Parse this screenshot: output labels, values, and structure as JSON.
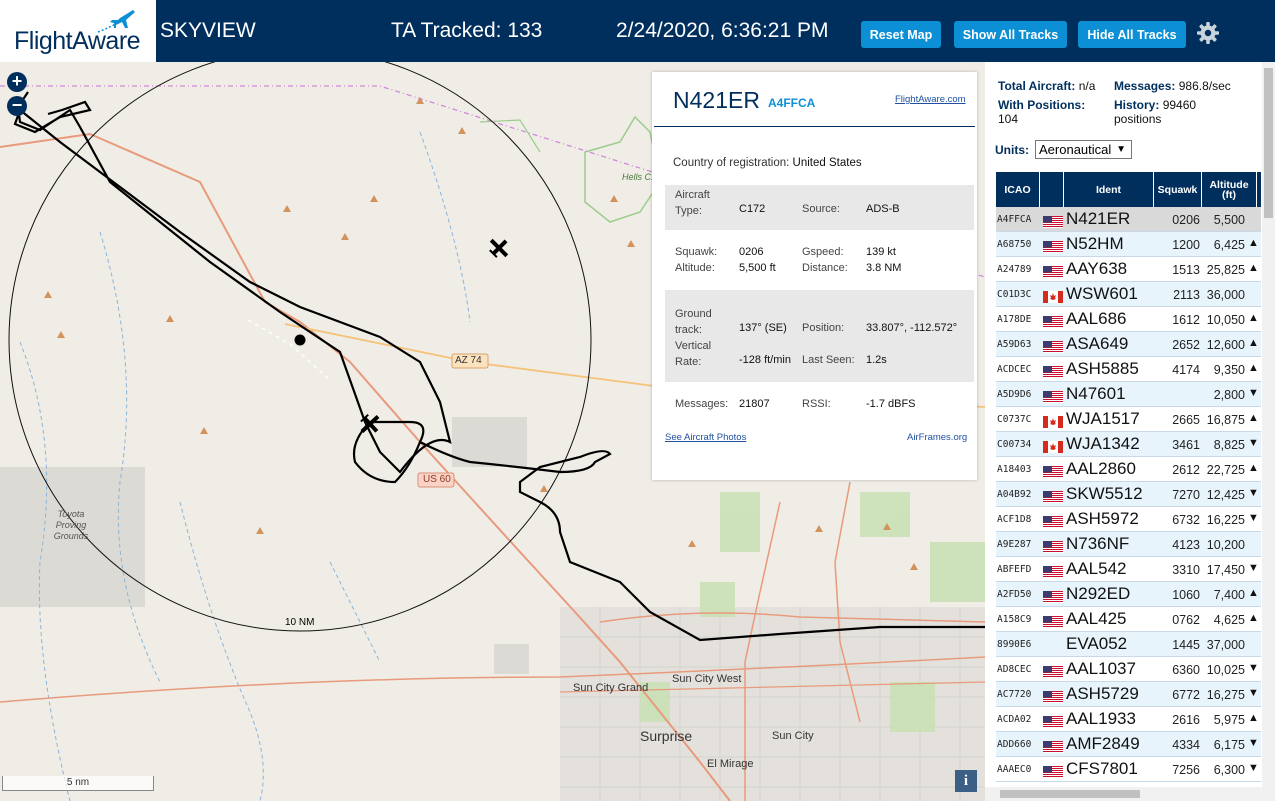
{
  "header": {
    "logo": "FlightAware",
    "app_title": "SKYVIEW",
    "ta_tracked": "TA Tracked: 133",
    "datetime": "2/24/2020, 6:36:21 PM",
    "reset_map": "Reset Map",
    "show_all_tracks": "Show All Tracks",
    "hide_all_tracks": "Hide All Tracks"
  },
  "map": {
    "zoom_in": "+",
    "zoom_out": "−",
    "range_ring_label": "10 NM",
    "scale_label": "5 nm",
    "info": "i",
    "labels": {
      "az74": "AZ 74",
      "us60": "US 60",
      "hells_canyon": "Hells C...",
      "toyota": "Toyota Proving Grounds",
      "sun_city_grand": "Sun City Grand",
      "sun_city_west": "Sun City West",
      "surprise": "Surprise",
      "sun_city": "Sun City",
      "el_mirage": "El Mirage"
    }
  },
  "aircraft": {
    "ident": "N421ER",
    "hex": "A4FFCA",
    "fa_link": "FlightAware.com",
    "country_label": "Country of registration:",
    "country": "United States",
    "type_label": "Aircraft Type:",
    "type": "C172",
    "source_label": "Source:",
    "source": "ADS-B",
    "squawk_label": "Squawk:",
    "squawk": "0206",
    "gspeed_label": "Gspeed:",
    "gspeed": "139 kt",
    "altitude_label": "Altitude:",
    "altitude": "5,500 ft",
    "distance_label": "Distance:",
    "distance": "3.8 NM",
    "track_label": "Ground track:",
    "track": "137° (SE)",
    "position_label": "Position:",
    "position": "33.807°, -112.572°",
    "vrate_label": "Vertical Rate:",
    "vrate": "-128 ft/min",
    "lastseen_label": "Last Seen:",
    "lastseen": "1.2s",
    "messages_label": "Messages:",
    "messages": "21807",
    "rssi_label": "RSSI:",
    "rssi": "-1.7 dBFS",
    "photos_link": "See Aircraft Photos",
    "airframes": "AirFrames.org"
  },
  "sidebar": {
    "total_label": "Total Aircraft:",
    "total": "n/a",
    "messages_label": "Messages:",
    "messages": "986.8/sec",
    "with_pos_label": "With Positions:",
    "with_pos": "104",
    "history_label": "History:",
    "history": "99460 positions",
    "units_label": "Units:",
    "units_value": "Aeronautical",
    "columns": [
      "ICAO",
      "",
      "Ident",
      "Squawk",
      "Altitude (ft)"
    ],
    "rows": [
      {
        "icao": "A4FFCA",
        "flag": "us",
        "ident": "N421ER",
        "squawk": "0206",
        "alt": "5,500",
        "vr": ""
      },
      {
        "icao": "A68750",
        "flag": "us",
        "ident": "N52HM",
        "squawk": "1200",
        "alt": "6,425",
        "vr": "▲"
      },
      {
        "icao": "A24789",
        "flag": "us",
        "ident": "AAY638",
        "squawk": "1513",
        "alt": "25,825",
        "vr": "▲"
      },
      {
        "icao": "C01D3C",
        "flag": "ca",
        "ident": "WSW601",
        "squawk": "2113",
        "alt": "36,000",
        "vr": ""
      },
      {
        "icao": "A178DE",
        "flag": "us",
        "ident": "AAL686",
        "squawk": "1612",
        "alt": "10,050",
        "vr": "▲"
      },
      {
        "icao": "A59D63",
        "flag": "us",
        "ident": "ASA649",
        "squawk": "2652",
        "alt": "12,600",
        "vr": "▲"
      },
      {
        "icao": "ACDCEC",
        "flag": "us",
        "ident": "ASH5885",
        "squawk": "4174",
        "alt": "9,350",
        "vr": "▲"
      },
      {
        "icao": "A5D9D6",
        "flag": "us",
        "ident": "N47601",
        "squawk": "",
        "alt": "2,800",
        "vr": "▼"
      },
      {
        "icao": "C0737C",
        "flag": "ca",
        "ident": "WJA1517",
        "squawk": "2665",
        "alt": "16,875",
        "vr": "▲"
      },
      {
        "icao": "C00734",
        "flag": "ca",
        "ident": "WJA1342",
        "squawk": "3461",
        "alt": "8,825",
        "vr": "▼"
      },
      {
        "icao": "A18403",
        "flag": "us",
        "ident": "AAL2860",
        "squawk": "2612",
        "alt": "22,725",
        "vr": "▲"
      },
      {
        "icao": "A04B92",
        "flag": "us",
        "ident": "SKW5512",
        "squawk": "7270",
        "alt": "12,425",
        "vr": "▼"
      },
      {
        "icao": "ACF1D8",
        "flag": "us",
        "ident": "ASH5972",
        "squawk": "6732",
        "alt": "16,225",
        "vr": "▼"
      },
      {
        "icao": "A9E287",
        "flag": "us",
        "ident": "N736NF",
        "squawk": "4123",
        "alt": "10,200",
        "vr": ""
      },
      {
        "icao": "ABFEFD",
        "flag": "us",
        "ident": "AAL542",
        "squawk": "3310",
        "alt": "17,450",
        "vr": "▼"
      },
      {
        "icao": "A2FD50",
        "flag": "us",
        "ident": "N292ED",
        "squawk": "1060",
        "alt": "7,400",
        "vr": "▲"
      },
      {
        "icao": "A158C9",
        "flag": "us",
        "ident": "AAL425",
        "squawk": "0762",
        "alt": "4,625",
        "vr": "▲"
      },
      {
        "icao": "8990E6",
        "flag": "",
        "ident": "EVA052",
        "squawk": "1445",
        "alt": "37,000",
        "vr": ""
      },
      {
        "icao": "AD8CEC",
        "flag": "us",
        "ident": "AAL1037",
        "squawk": "6360",
        "alt": "10,025",
        "vr": "▼"
      },
      {
        "icao": "AC7720",
        "flag": "us",
        "ident": "ASH5729",
        "squawk": "6772",
        "alt": "16,275",
        "vr": "▼"
      },
      {
        "icao": "ACDA02",
        "flag": "us",
        "ident": "AAL1933",
        "squawk": "2616",
        "alt": "5,975",
        "vr": "▲"
      },
      {
        "icao": "ADD660",
        "flag": "us",
        "ident": "AMF2849",
        "squawk": "4334",
        "alt": "6,175",
        "vr": "▼"
      },
      {
        "icao": "AAAEC0",
        "flag": "us",
        "ident": "CFS7801",
        "squawk": "7256",
        "alt": "6,300",
        "vr": "▼"
      }
    ]
  },
  "colors": {
    "navy": "#002f5d",
    "button_blue": "#0d8fd6",
    "track": "#000000"
  }
}
